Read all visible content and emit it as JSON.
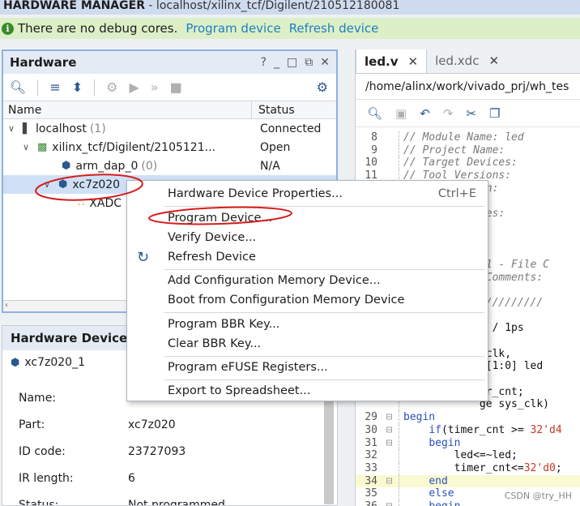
{
  "title": {
    "app": "HARDWARE MANAGER",
    "path": " - localhost/xilinx_tcf/Digilent/210512180081"
  },
  "infobar": {
    "message": "There are no debug cores.",
    "link_program": "Program device",
    "link_refresh": "Refresh device"
  },
  "hardware_panel": {
    "title": "Hardware",
    "controls": [
      "?",
      "_",
      "□",
      "⧉",
      "✕"
    ],
    "columns": {
      "name": "Name",
      "status": "Status"
    },
    "rows": [
      {
        "name": "localhost",
        "count": "(1)",
        "status": "Connected"
      },
      {
        "name": "xilinx_tcf/Digilent/2105121...",
        "count": "",
        "status": "Open"
      },
      {
        "name": "arm_dap_0",
        "count": "(0)",
        "status": "N/A"
      },
      {
        "name": "xc7z020",
        "count": "",
        "status": ""
      },
      {
        "name": "XADC",
        "count": "",
        "status": ""
      }
    ]
  },
  "properties_panel": {
    "title": "Hardware Device",
    "device": "xc7z020_1",
    "rows": [
      {
        "key": "Name:",
        "value": ""
      },
      {
        "key": "Part:",
        "value": "xc7z020"
      },
      {
        "key": "ID code:",
        "value": "23727093"
      },
      {
        "key": "IR length:",
        "value": "6"
      },
      {
        "key": "Status:",
        "value": "Not programmed"
      }
    ]
  },
  "editor": {
    "tabs": [
      {
        "label": "led.v",
        "active": true
      },
      {
        "label": "led.xdc",
        "active": false
      }
    ],
    "path": "/home/alinx/work/vivado_prj/wh_tes",
    "lines": [
      {
        "n": "8",
        "t": "// Module Name: led",
        "c": true
      },
      {
        "n": "9",
        "t": "// Project Name:",
        "c": true
      },
      {
        "n": "10",
        "t": "// Target Devices:",
        "c": true
      },
      {
        "n": "11",
        "t": "// Tool Versions:",
        "c": true
      },
      {
        "n": "",
        "t": "             n:",
        "c": true
      },
      {
        "n": "",
        "t": "",
        "c": false
      },
      {
        "n": "",
        "t": "             es:",
        "c": true
      },
      {
        "n": "",
        "t": "",
        "c": false
      },
      {
        "n": "",
        "t": "",
        "c": false
      },
      {
        "n": "",
        "t": "",
        "c": false
      },
      {
        "n": "",
        "t": "          0.01 - File C",
        "c": true
      },
      {
        "n": "",
        "t": "           l Comments:",
        "c": true
      },
      {
        "n": "",
        "t": "",
        "c": false
      },
      {
        "n": "",
        "t": "            //////////",
        "c": true
      },
      {
        "n": "",
        "t": "",
        "c": false
      },
      {
        "n": "",
        "t": "            s / 1ps",
        "c": false
      },
      {
        "n": "",
        "t": "",
        "c": false
      },
      {
        "n": "",
        "t": "            _clk,",
        "c": false
      },
      {
        "n": "",
        "t": "            g[1:0] led",
        "c": false
      },
      {
        "n": "",
        "t": "",
        "c": false
      },
      {
        "n": "",
        "t": "            er_cnt;",
        "c": false
      },
      {
        "n": "",
        "t": "            ge sys_clk)",
        "c": false
      },
      {
        "n": "29",
        "t": "begin",
        "c": false
      },
      {
        "n": "30",
        "t": "    if(timer_cnt >= 32'd4",
        "c": false
      },
      {
        "n": "31",
        "t": "    begin",
        "c": false
      },
      {
        "n": "32",
        "t": "        led<=~led;",
        "c": false
      },
      {
        "n": "33",
        "t": "        timer_cnt<=32'd0;",
        "c": false
      },
      {
        "n": "34",
        "t": "    end",
        "c": false
      },
      {
        "n": "35",
        "t": "    else",
        "c": false
      },
      {
        "n": "36",
        "t": "    begin",
        "c": false
      }
    ]
  },
  "context_menu": {
    "items": [
      {
        "label": "Hardware Device Properties...",
        "shortcut": "Ctrl+E"
      },
      {
        "label": "Program Device...",
        "shortcut": ""
      },
      {
        "label": "Verify Device...",
        "shortcut": ""
      },
      {
        "label": "Refresh Device",
        "shortcut": ""
      },
      {
        "label": "Add Configuration Memory Device...",
        "shortcut": ""
      },
      {
        "label": "Boot from Configuration Memory Device",
        "shortcut": ""
      },
      {
        "label": "Program BBR Key...",
        "shortcut": ""
      },
      {
        "label": "Clear BBR Key...",
        "shortcut": ""
      },
      {
        "label": "Program eFUSE Registers...",
        "shortcut": ""
      },
      {
        "label": "Export to Spreadsheet...",
        "shortcut": ""
      }
    ]
  },
  "watermark": "CSDN @try_HH",
  "colors": {
    "accent": "#1f7fc4",
    "selection": "#cfe0f6",
    "annotation": "#d71c1c",
    "info_bg": "#dcefc6"
  }
}
